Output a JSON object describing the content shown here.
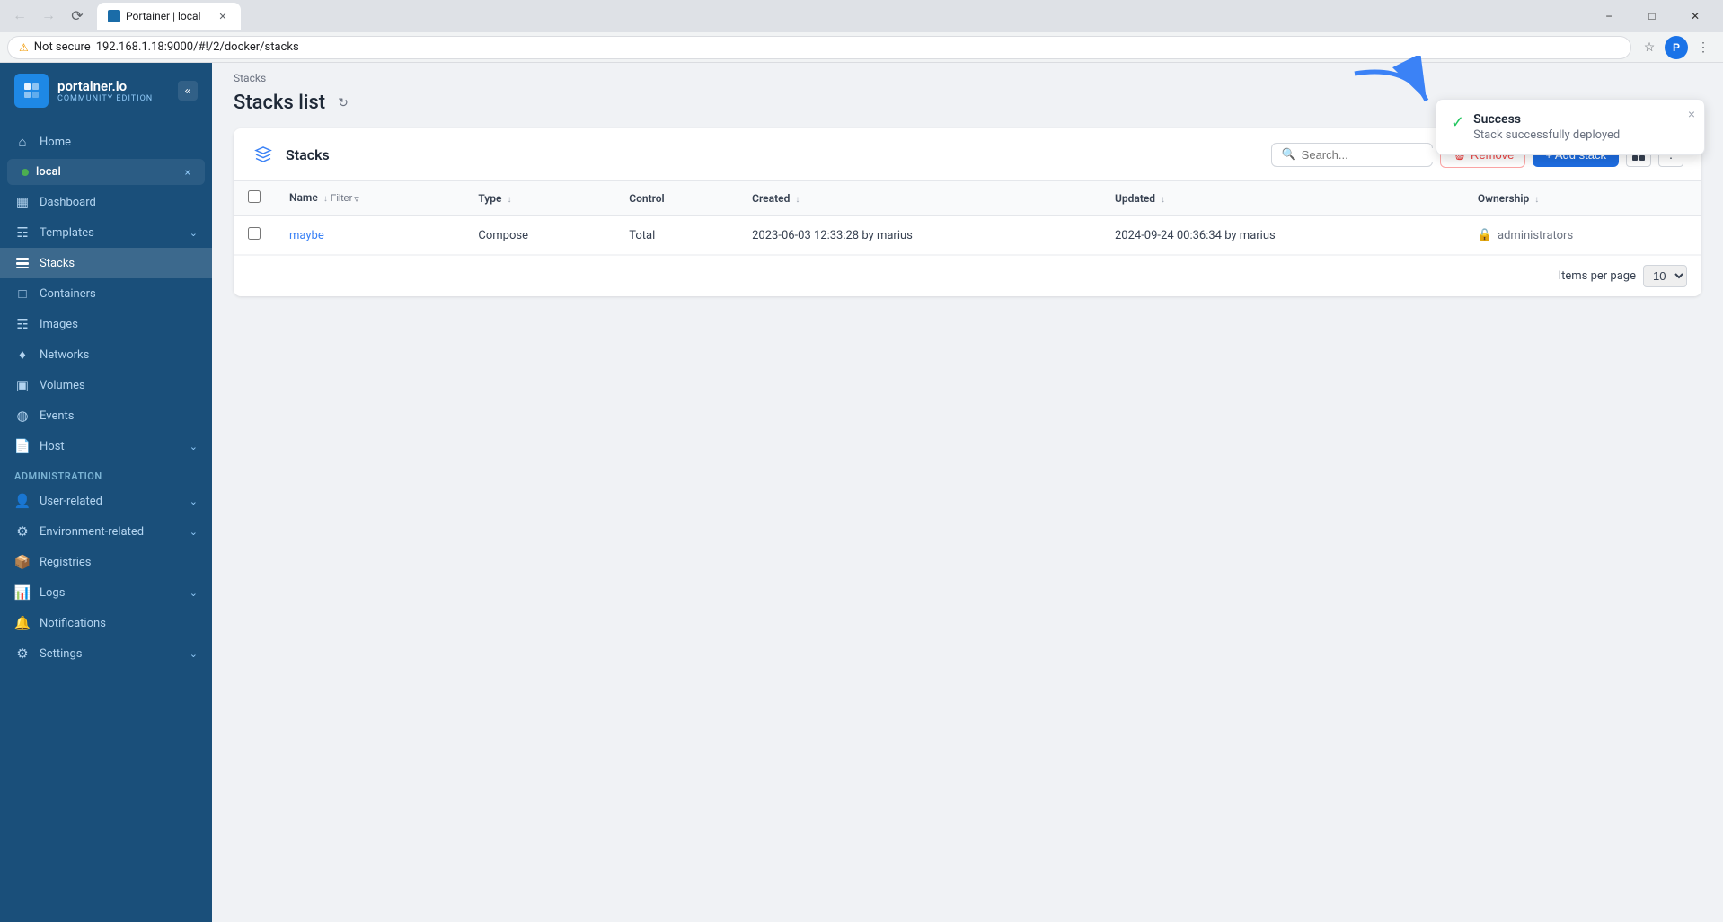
{
  "browser": {
    "tab_title": "Portainer | local",
    "tab_favicon": "P",
    "address": "192.168.1.18:9000/#!/2/docker/stacks",
    "security_label": "Not secure"
  },
  "sidebar": {
    "logo_name": "portainer.io",
    "logo_sub": "COMMUNITY EDITION",
    "collapse_label": "«",
    "home_label": "Home",
    "env_name": "local",
    "env_close": "×",
    "dashboard_label": "Dashboard",
    "templates_label": "Templates",
    "stacks_label": "Stacks",
    "containers_label": "Containers",
    "images_label": "Images",
    "networks_label": "Networks",
    "volumes_label": "Volumes",
    "events_label": "Events",
    "host_label": "Host",
    "admin_section": "Administration",
    "user_related_label": "User-related",
    "environment_related_label": "Environment-related",
    "registries_label": "Registries",
    "logs_label": "Logs",
    "notifications_label": "Notifications",
    "settings_label": "Settings"
  },
  "main": {
    "breadcrumb": "Stacks",
    "page_title": "Stacks list",
    "card_title": "Stacks",
    "search_placeholder": "Search...",
    "remove_label": "Remove",
    "add_stack_label": "+ Add stack",
    "table": {
      "headers": {
        "name": "Name",
        "type": "Type",
        "control": "Control",
        "created": "Created",
        "updated": "Updated",
        "ownership": "Ownership"
      },
      "rows": [
        {
          "name": "maybe",
          "type": "Compose",
          "control": "Total",
          "created": "2023-06-03 12:33:28 by marius",
          "updated": "2024-09-24 00:36:34 by marius",
          "ownership": "administrators"
        }
      ],
      "items_per_page_label": "Items per page",
      "items_per_page_value": "10"
    }
  },
  "toast": {
    "title": "Success",
    "message": "Stack successfully deployed",
    "close_label": "×"
  }
}
